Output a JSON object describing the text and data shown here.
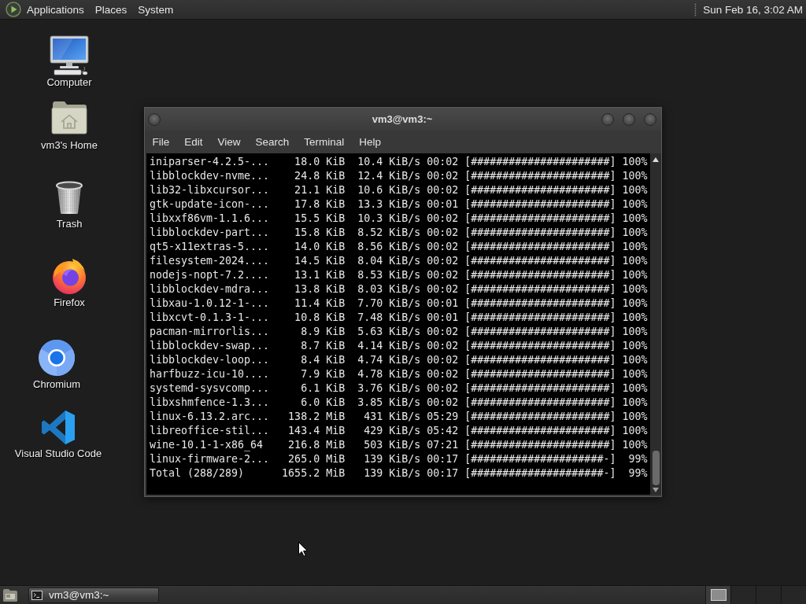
{
  "top_panel": {
    "menus": [
      "Applications",
      "Places",
      "System"
    ],
    "clock": "Sun Feb 16, 3:02 AM"
  },
  "desktop_icons": [
    {
      "kind": "computer",
      "label": "Computer"
    },
    {
      "kind": "home",
      "label": "vm3's Home"
    },
    {
      "kind": "trash",
      "label": "Trash"
    },
    {
      "kind": "firefox",
      "label": "Firefox"
    },
    {
      "kind": "chromium",
      "label": "Chromium"
    },
    {
      "kind": "vscode",
      "label": "Visual Studio Code"
    }
  ],
  "terminal": {
    "title": "vm3@vm3:~",
    "menu": [
      "File",
      "Edit",
      "View",
      "Search",
      "Terminal",
      "Help"
    ],
    "lines": [
      "iniparser-4.2.5-...    18.0 KiB  10.4 KiB/s 00:02 [######################] 100%",
      "libblockdev-nvme...    24.8 KiB  12.4 KiB/s 00:02 [######################] 100%",
      "lib32-libxcursor...    21.1 KiB  10.6 KiB/s 00:02 [######################] 100%",
      "gtk-update-icon-...    17.8 KiB  13.3 KiB/s 00:01 [######################] 100%",
      "libxxf86vm-1.1.6...    15.5 KiB  10.3 KiB/s 00:02 [######################] 100%",
      "libblockdev-part...    15.8 KiB  8.52 KiB/s 00:02 [######################] 100%",
      "qt5-x11extras-5....    14.0 KiB  8.56 KiB/s 00:02 [######################] 100%",
      "filesystem-2024....    14.5 KiB  8.04 KiB/s 00:02 [######################] 100%",
      "nodejs-nopt-7.2....    13.1 KiB  8.53 KiB/s 00:02 [######################] 100%",
      "libblockdev-mdra...    13.8 KiB  8.03 KiB/s 00:02 [######################] 100%",
      "libxau-1.0.12-1-...    11.4 KiB  7.70 KiB/s 00:01 [######################] 100%",
      "libxcvt-0.1.3-1-...    10.8 KiB  7.48 KiB/s 00:01 [######################] 100%",
      "pacman-mirrorlis...     8.9 KiB  5.63 KiB/s 00:02 [######################] 100%",
      "libblockdev-swap...     8.7 KiB  4.14 KiB/s 00:02 [######################] 100%",
      "libblockdev-loop...     8.4 KiB  4.74 KiB/s 00:02 [######################] 100%",
      "harfbuzz-icu-10....     7.9 KiB  4.78 KiB/s 00:02 [######################] 100%",
      "systemd-sysvcomp...     6.1 KiB  3.76 KiB/s 00:02 [######################] 100%",
      "libxshmfence-1.3...     6.0 KiB  3.85 KiB/s 00:02 [######################] 100%",
      "linux-6.13.2.arc...   138.2 MiB   431 KiB/s 05:29 [######################] 100%",
      "libreoffice-stil...   143.4 MiB   429 KiB/s 05:42 [######################] 100%",
      "wine-10.1-1-x86_64    216.8 MiB   503 KiB/s 07:21 [######################] 100%",
      "linux-firmware-2...   265.0 MiB   139 KiB/s 00:17 [#####################-]  99%",
      "Total (288/289)      1655.2 MiB   139 KiB/s 00:17 [#####################-]  99%"
    ]
  },
  "bottom_panel": {
    "task": "vm3@vm3:~",
    "workspaces": [
      {
        "selected": true
      },
      {
        "selected": false
      },
      {
        "selected": false
      },
      {
        "selected": false
      }
    ]
  }
}
